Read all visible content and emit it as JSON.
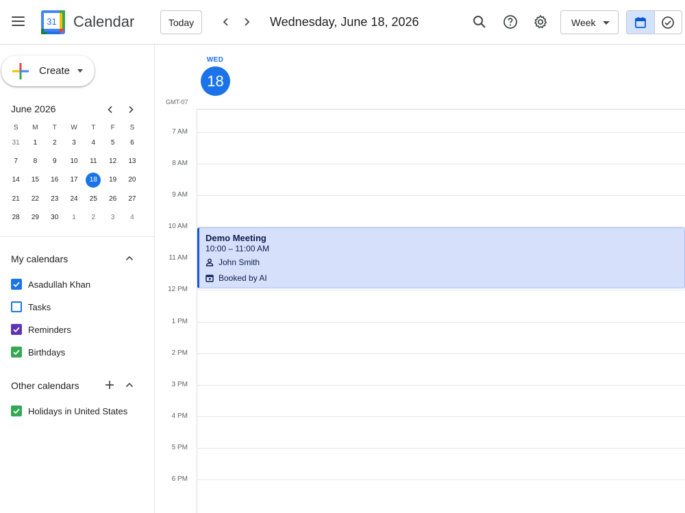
{
  "header": {
    "app_title": "Calendar",
    "logo_day": "31",
    "today_label": "Today",
    "date_title": "Wednesday, June 18, 2026",
    "view_label": "Week",
    "icons": [
      "menu-icon",
      "prev-icon",
      "next-icon",
      "search-icon",
      "help-icon",
      "settings-icon",
      "calendar-view-icon",
      "tasks-view-icon"
    ]
  },
  "sidebar": {
    "create_label": "Create",
    "mini_calendar": {
      "title": "June 2026",
      "weekdays": [
        "S",
        "M",
        "T",
        "W",
        "T",
        "F",
        "S"
      ],
      "weeks": [
        [
          "31",
          "1",
          "2",
          "3",
          "4",
          "5",
          "6"
        ],
        [
          "7",
          "8",
          "9",
          "10",
          "11",
          "12",
          "13"
        ],
        [
          "14",
          "15",
          "16",
          "17",
          "18",
          "19",
          "20"
        ],
        [
          "21",
          "22",
          "23",
          "24",
          "25",
          "26",
          "27"
        ],
        [
          "28",
          "29",
          "30",
          "1",
          "2",
          "3",
          "4"
        ]
      ],
      "selected": "18"
    },
    "my_calendars": {
      "title": "My calendars",
      "items": [
        {
          "label": "Asadullah Khan",
          "checked": true,
          "color": "#1a73e8"
        },
        {
          "label": "Tasks",
          "checked": false,
          "color": "#1a73e8"
        },
        {
          "label": "Reminders",
          "checked": true,
          "color": "#5e35b1"
        },
        {
          "label": "Birthdays",
          "checked": true,
          "color": "#34a853"
        }
      ]
    },
    "other_calendars": {
      "title": "Other calendars",
      "items": [
        {
          "label": "Holidays in United States",
          "checked": true,
          "color": "#34a853"
        }
      ]
    }
  },
  "main": {
    "day_abbr": "WED",
    "day_number": "18",
    "timezone": "GMT-07",
    "hours": [
      "7 AM",
      "8 AM",
      "9 AM",
      "10 AM",
      "11 AM",
      "12 PM",
      "1 PM",
      "2 PM",
      "3 PM",
      "4 PM",
      "5 PM",
      "6 PM"
    ],
    "event": {
      "title": "Demo Meeting",
      "time": "10:00 – 11:00 AM",
      "person": "John Smith",
      "booked": "Booked by AI"
    }
  },
  "colors": {
    "accent": "#1a73e8",
    "event_bg": "#d7e0fb",
    "event_border": "#1a56db"
  }
}
